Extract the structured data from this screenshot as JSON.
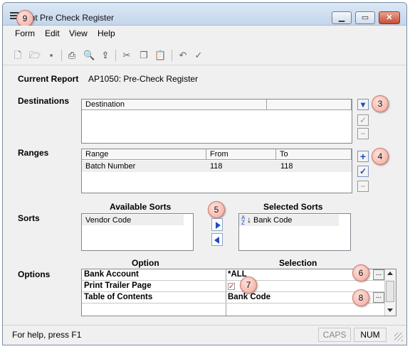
{
  "window": {
    "title": "Print Pre Check Register",
    "minimize": "▁",
    "maximize": "▭",
    "close": "✕"
  },
  "menu": {
    "items": [
      "Form",
      "Edit",
      "View",
      "Help"
    ]
  },
  "toolbar": {
    "icons": [
      "new-file-icon",
      "open-folder-icon",
      "save-icon",
      "print-icon",
      "print-preview-icon",
      "export-icon",
      "cut-icon",
      "copy-icon",
      "paste-icon",
      "undo-icon",
      "spellcheck-icon"
    ]
  },
  "report": {
    "label": "Current Report",
    "value": "AP1050:  Pre-Check Register"
  },
  "destinations": {
    "label": "Destinations",
    "column": "Destination"
  },
  "ranges": {
    "label": "Ranges",
    "columns": [
      "Range",
      "From",
      "To"
    ],
    "rows": [
      {
        "range": "Batch Number",
        "from": "118",
        "to": "118"
      }
    ]
  },
  "sorts": {
    "label": "Sorts",
    "available_title": "Available Sorts",
    "selected_title": "Selected Sorts",
    "available": [
      "Vendor Code"
    ],
    "selected": [
      "Bank Code"
    ],
    "sort_icon_text": "AZ"
  },
  "options": {
    "label": "Options",
    "option_header": "Option",
    "selection_header": "Selection",
    "rows": [
      {
        "option": "Bank Account",
        "selection": "*ALL",
        "has_lookup": true
      },
      {
        "option": "Print Trailer Page",
        "selection": "",
        "checked": true
      },
      {
        "option": "Table of Contents",
        "selection": "Bank Code",
        "has_lookup": true
      }
    ],
    "lookup_label": "..."
  },
  "callouts": [
    "9",
    "3",
    "4",
    "5",
    "6",
    "7",
    "8"
  ],
  "status": {
    "help": "For help, press F1",
    "caps": "CAPS",
    "num": "NUM"
  },
  "colors": {
    "accent_blue": "#1b4fbf",
    "callout": "#f3a79a",
    "check_red": "#cc2222"
  }
}
